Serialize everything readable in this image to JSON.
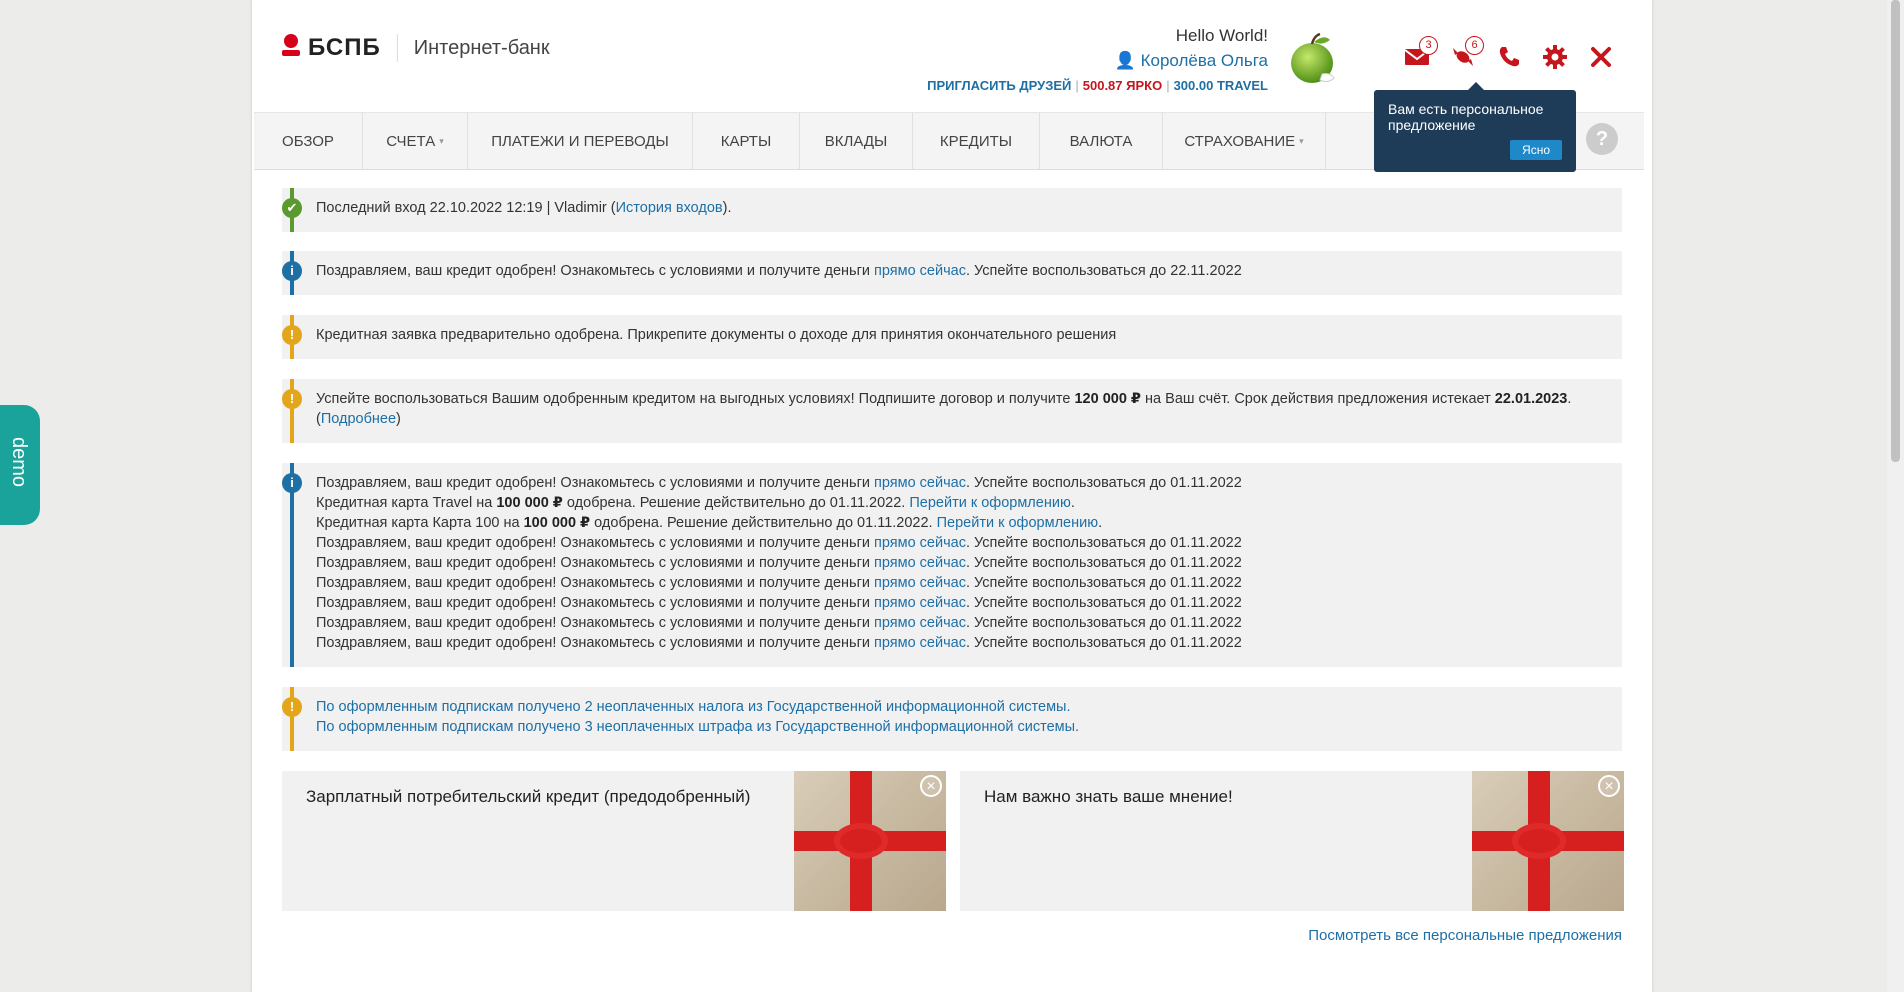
{
  "header": {
    "logo_text": "БСПБ",
    "subtitle": "Интернет-банк",
    "greeting": "Hello World!",
    "user_name": "Королёва Ольга",
    "invite": "ПРИГЛАСИТЬ ДРУЗЕЙ",
    "yarko": "500.87 ЯРКО",
    "travel": "300.00 TRAVEL",
    "mail_badge": "3",
    "offers_badge": "6"
  },
  "nav": {
    "items": [
      "ОБЗОР",
      "СЧЕТА",
      "ПЛАТЕЖИ И ПЕРЕВОДЫ",
      "КАРТЫ",
      "ВКЛАДЫ",
      "КРЕДИТЫ",
      "ВАЛЮТА",
      "СТРАХОВАНИЕ"
    ],
    "help": "?"
  },
  "tooltip": {
    "text": "Вам есть персональное предложение",
    "button": "Ясно"
  },
  "alerts": {
    "login": {
      "text": "Последний вход 22.10.2022 12:19 | Vladimir (",
      "link": "История входов",
      "tail": ")."
    },
    "credit1": {
      "text": "Поздравляем, ваш кредит одобрен! Ознакомьтесь с условиями и получите деньги ",
      "link": "прямо сейчас",
      "tail": ". Успейте воспользоваться до 22.11.2022"
    },
    "credit_app": {
      "text": "Кредитная заявка предварительно одобрена. Прикрепите документы о доходе для принятия окончательного решения"
    },
    "offer": {
      "text1": "Успейте воспользоваться Вашим одобренным кредитом на выгодных условиях! Подпишите договор и получите ",
      "amount": "120 000 ₽",
      "text2": " на Ваш счёт. Срок действия предложения истекает ",
      "date": "22.01.2023",
      "text3": ".",
      "paren_open": "(",
      "link": "Подробнее",
      "paren_close": ")"
    },
    "multi": {
      "congrats": "Поздравляем, ваш кредит одобрен! Ознакомьтесь с условиями и получите деньги ",
      "link": "прямо сейчас",
      "tail": ". Успейте воспользоваться до 01.11.2022",
      "travel_pre": "Кредитная карта Travel на ",
      "travel_amount": "100 000 ₽",
      "travel_post": " одобрена. Решение действительно до 01.11.2022. ",
      "card100_pre": "Кредитная карта Карта 100 на ",
      "card100_amount": "100 000 ₽",
      "card100_post": " одобрена. Решение действительно до 01.11.2022. ",
      "go_link": "Перейти к оформлению",
      "dot": "."
    },
    "taxes": {
      "line1": "По оформленным подпискам получено 2 неоплаченных налога из Государственной информационной системы.",
      "line2": "По оформленным подпискам получено 3 неоплаченных штрафа из Государственной информационной системы."
    }
  },
  "cards": [
    {
      "title": "Зарплатный потребительский кредит (предодобренный)"
    },
    {
      "title": "Нам важно знать ваше мнение!"
    }
  ],
  "see_all": "Посмотреть все персональные предложения",
  "demo": "demo",
  "colors": {
    "brand_red": "#d6001c",
    "link_blue": "#1d6fa6",
    "ok_green": "#5a9a2e",
    "warn_yellow": "#e3a51a",
    "info_blue": "#1e6fa3",
    "demo_teal": "#1aa39b"
  }
}
